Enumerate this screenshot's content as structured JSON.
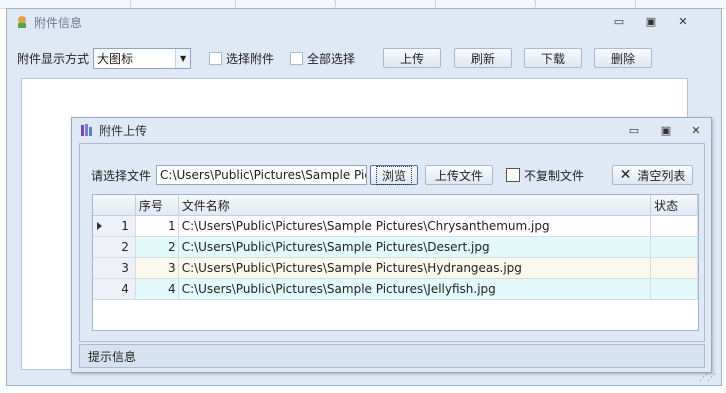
{
  "outer_window": {
    "title": "附件信息",
    "controls": {
      "minimize": "▭",
      "restore": "▣",
      "close": "✕"
    },
    "toolbar": {
      "display_mode_label": "附件显示方式",
      "display_mode_value": "大图标",
      "select_attachment_label": "选择附件",
      "select_all_label": "全部选择",
      "upload_button": "上传",
      "refresh_button": "刷新",
      "download_button": "下载",
      "delete_button": "删除"
    }
  },
  "inner_window": {
    "title": "附件上传",
    "controls": {
      "minimize": "▭",
      "restore": "▣",
      "close": "✕"
    },
    "select_file_label": "请选择文件",
    "file_path_value": "C:\\Users\\Public\\Pictures\\Sample Pictures",
    "browse_button": "浏览",
    "upload_file_button": "上传文件",
    "no_copy_label": "不复制文件",
    "clear_list_button": "清空列表",
    "grid": {
      "headers": [
        "序号",
        "文件名称",
        "状态"
      ],
      "rows": [
        {
          "row_no": "1",
          "seq": "1",
          "path": "C:\\Users\\Public\\Pictures\\Sample Pictures\\Chrysanthemum.jpg",
          "status": ""
        },
        {
          "row_no": "2",
          "seq": "2",
          "path": "C:\\Users\\Public\\Pictures\\Sample Pictures\\Desert.jpg",
          "status": ""
        },
        {
          "row_no": "3",
          "seq": "3",
          "path": "C:\\Users\\Public\\Pictures\\Sample Pictures\\Hydrangeas.jpg",
          "status": ""
        },
        {
          "row_no": "4",
          "seq": "4",
          "path": "C:\\Users\\Public\\Pictures\\Sample Pictures\\Jellyfish.jpg",
          "status": ""
        }
      ]
    },
    "status_bar": "提示信息"
  },
  "colors": {
    "window_bg": "#dfe8f5",
    "row_alt_cyan": "#e2fafa",
    "row_alt_cream": "#fbf8ee"
  }
}
